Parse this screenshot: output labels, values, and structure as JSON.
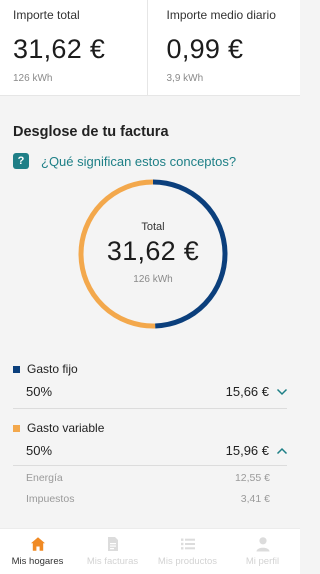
{
  "summary": {
    "total": {
      "label": "Importe total",
      "value": "31,62 €",
      "sub": "126 kWh"
    },
    "daily": {
      "label": "Importe medio diario",
      "value": "0,99 €",
      "sub": "3,9 kWh"
    }
  },
  "breakdown": {
    "title": "Desglose de tu factura",
    "help_icon_text": "?",
    "help_link": "¿Qué significan estos conceptos?",
    "donut": {
      "label": "Total",
      "value": "31,62 €",
      "sub": "126 kWh"
    },
    "items": [
      {
        "name": "Gasto fijo",
        "percent": "50%",
        "amount": "15,66 €",
        "share": 0.4953,
        "color": "#0b3f7c",
        "expanded": false
      },
      {
        "name": "Gasto variable",
        "percent": "50%",
        "amount": "15,96 €",
        "share": 0.5047,
        "color": "#f3a84c",
        "expanded": true
      }
    ],
    "variable_details": [
      {
        "label": "Energía",
        "amount": "12,55 €"
      },
      {
        "label": "Impuestos",
        "amount": "3,41 €"
      }
    ]
  },
  "nav": {
    "items": [
      {
        "label": "Mis hogares",
        "icon": "home-icon",
        "active": true
      },
      {
        "label": "Mis facturas",
        "icon": "invoice-icon",
        "active": false
      },
      {
        "label": "Mis productos",
        "icon": "list-icon",
        "active": false
      },
      {
        "label": "Mi perfil",
        "icon": "person-icon",
        "active": false
      }
    ]
  },
  "colors": {
    "accent": "#f08a24",
    "teal": "#1d7f86",
    "navy": "#0b3f7c",
    "orange": "#f3a84c"
  }
}
